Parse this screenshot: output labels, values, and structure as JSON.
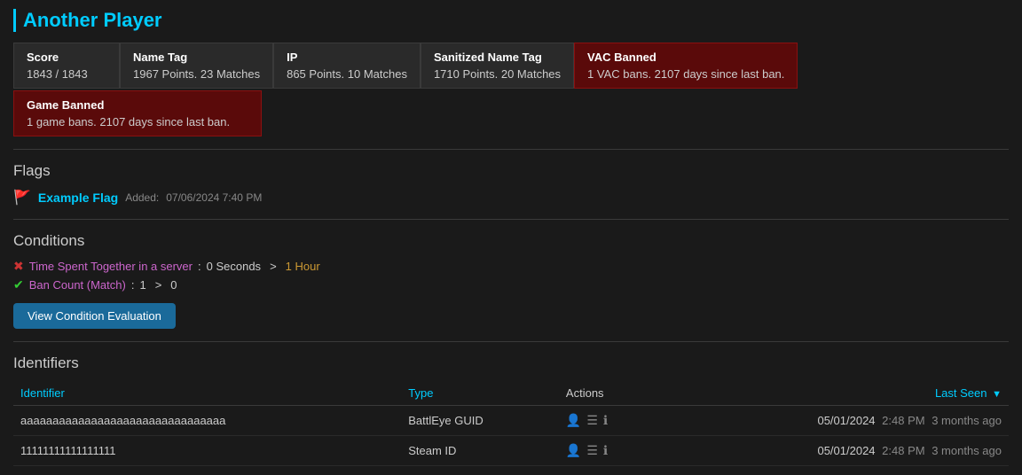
{
  "player": {
    "title": "Another Player"
  },
  "stats": {
    "score_label": "Score",
    "score_value": "1843 / 1843",
    "name_tag_label": "Name Tag",
    "name_tag_value": "1967 Points. 23 Matches",
    "ip_label": "IP",
    "ip_value": "865 Points. 10 Matches",
    "sanitized_label": "Sanitized Name Tag",
    "sanitized_value": "1710 Points. 20 Matches",
    "vac_label": "VAC Banned",
    "vac_value": "1 VAC bans. 2107 days since last ban.",
    "game_banned_label": "Game Banned",
    "game_banned_value": "1 game bans. 2107 days since last ban."
  },
  "flags": {
    "section_title": "Flags",
    "items": [
      {
        "name": "Example Flag",
        "added_prefix": "Added:",
        "date": "07/06/2024 7:40 PM"
      }
    ]
  },
  "conditions": {
    "section_title": "Conditions",
    "items": [
      {
        "status": "fail",
        "name": "Time Spent Together in a server",
        "separator": ":",
        "value": "0 Seconds",
        "gt": ">",
        "threshold": "1 Hour"
      },
      {
        "status": "pass",
        "name": "Ban Count (Match)",
        "separator": ":",
        "value": "1",
        "gt": ">",
        "threshold": "0"
      }
    ],
    "view_button": "View Condition Evaluation"
  },
  "identifiers": {
    "section_title": "Identifiers",
    "columns": {
      "identifier": "Identifier",
      "type": "Type",
      "actions": "Actions",
      "last_seen": "Last Seen"
    },
    "rows": [
      {
        "id": "aaaaaaaaaaaaaaaaaaaaaaaaaaaaaaaa",
        "type": "BattlEye GUID",
        "last_seen_date": "05/01/2024",
        "last_seen_time": "2:48 PM",
        "last_seen_ago": "3 months ago"
      },
      {
        "id": "11111111111111111",
        "type": "Steam ID",
        "last_seen_date": "05/01/2024",
        "last_seen_time": "2:48 PM",
        "last_seen_ago": "3 months ago"
      }
    ]
  }
}
